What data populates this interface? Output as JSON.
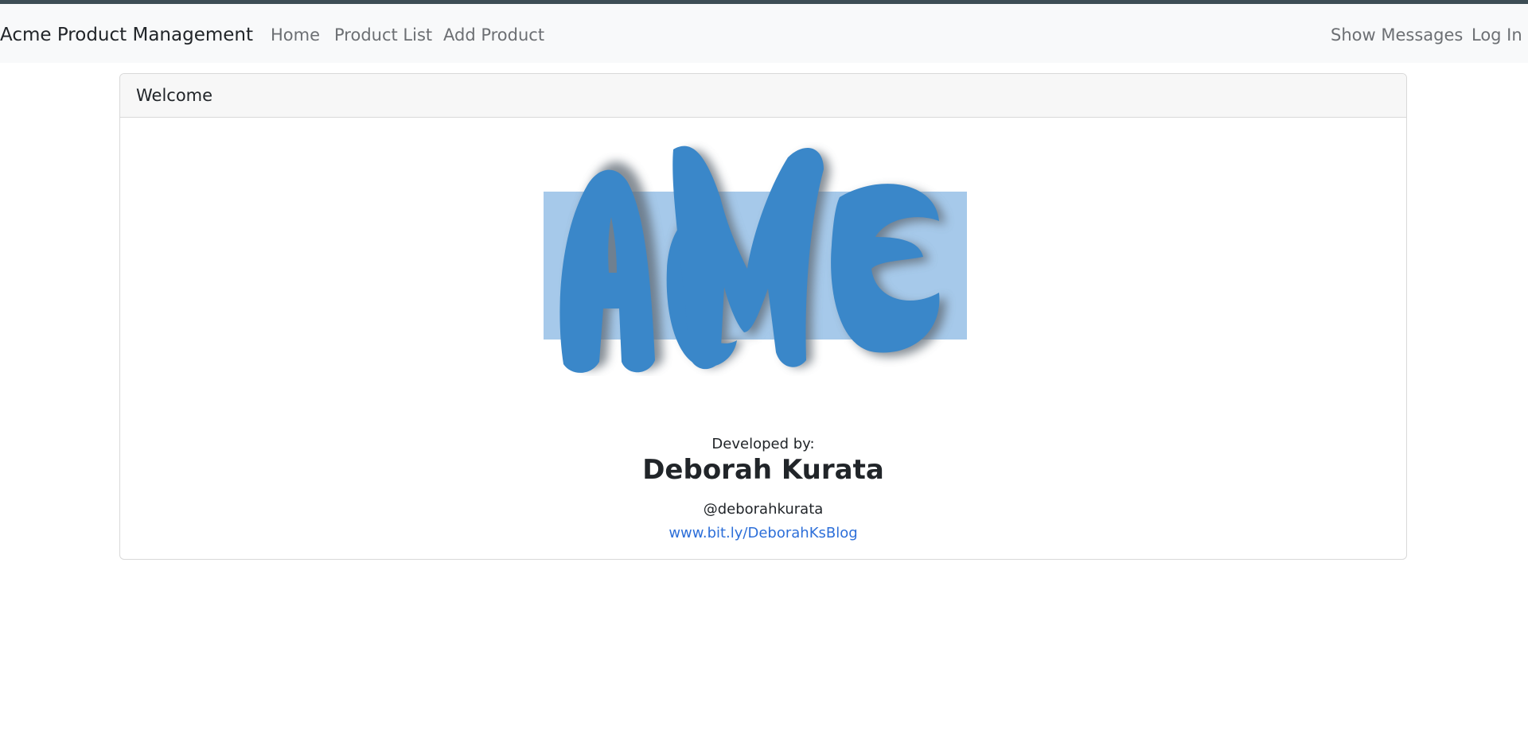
{
  "navbar": {
    "brand": "Acme Product Management",
    "links": [
      "Home",
      "Product List",
      "Add Product"
    ],
    "right_links": [
      "Show Messages",
      "Log In"
    ]
  },
  "card": {
    "header": "Welcome",
    "logo": {
      "text": "ACME",
      "icon": "acme-logo",
      "colors": {
        "fill": "#3a87c9",
        "box": "#a6c9ea",
        "shadow": "#5d6772"
      }
    },
    "developed_by_label": "Developed by:",
    "developer_name": "Deborah Kurata",
    "developer_handle": "@deborahkurata",
    "blog_link": "www.bit.ly/DeborahKsBlog"
  },
  "colors": {
    "top_strip": "#3d4d55",
    "navbar_bg": "#f8f9fa",
    "link": "#2d6fd9"
  }
}
